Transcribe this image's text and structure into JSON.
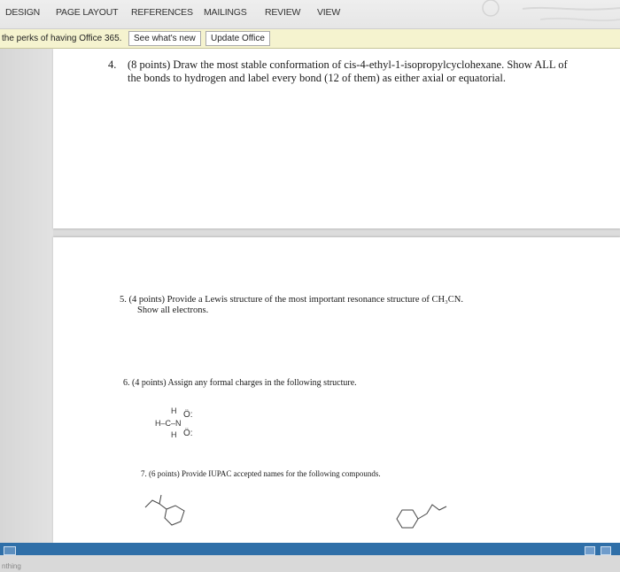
{
  "ribbon": {
    "tabs": [
      "DESIGN",
      "PAGE LAYOUT",
      "REFERENCES",
      "MAILINGS",
      "REVIEW",
      "VIEW"
    ]
  },
  "notice": {
    "text": "the perks of having Office 365.",
    "see_whats_new": "See what's new",
    "update_office": "Update Office"
  },
  "document": {
    "q4": {
      "number": "4.",
      "text": "(8 points) Draw the most stable conformation of cis-4-ethyl-1-isopropylcyclohexane. Show ALL of the bonds to hydrogen and label every bond (12 of them) as either axial or equatorial."
    },
    "q5": {
      "line1": "5.  (4 points) Provide a Lewis structure of the most important resonance structure of CH₃CN.",
      "line2": "Show all electrons."
    },
    "q6": {
      "text": "6.  (4 points) Assign any formal charges in the following structure."
    },
    "lewis": {
      "h_top": "H",
      "o_top": "Ö:",
      "main": "H–C–N",
      "h_bottom": "H",
      "o_bottom": "Ö:"
    },
    "q7": {
      "text": "7.  (6 points) Provide IUPAC accepted names for the following compounds."
    }
  },
  "taskbar": {
    "status_word": "nthing"
  }
}
